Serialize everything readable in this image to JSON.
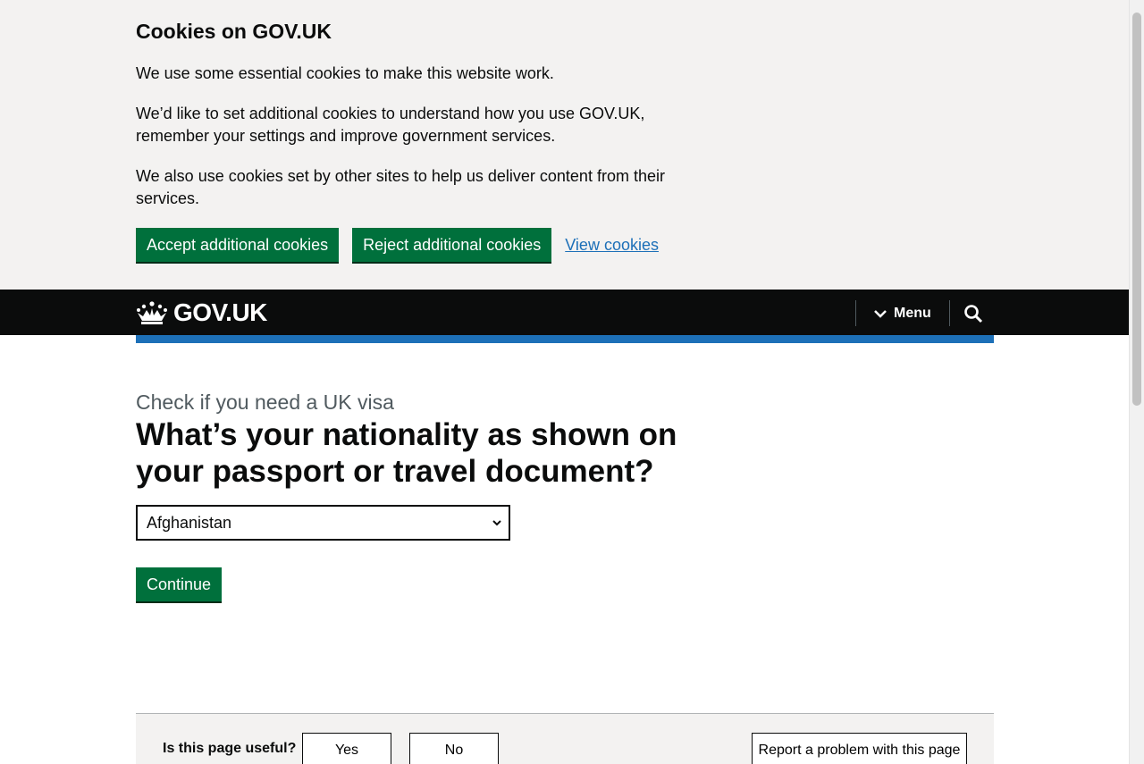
{
  "cookie_banner": {
    "title": "Cookies on GOV.UK",
    "paragraph_1": "We use some essential cookies to make this website work.",
    "paragraph_2": "We’d like to set additional cookies to understand how you use GOV.UK, remember your settings and improve government services.",
    "paragraph_3": "We also use cookies set by other sites to help us deliver content from their services.",
    "accept_label": "Accept additional cookies",
    "reject_label": "Reject additional cookies",
    "view_label": "View cookies"
  },
  "header": {
    "logo_text": "GOV.UK",
    "menu_label": "Menu",
    "search_icon": "search-icon"
  },
  "main": {
    "caption": "Check if you need a UK visa",
    "heading": "What’s your nationality as shown on your passport or travel document?",
    "select_value": "Afghanistan",
    "continue_label": "Continue"
  },
  "feedback": {
    "question": "Is this page useful?",
    "yes_label": "Yes",
    "no_label": "No",
    "report_label": "Report a problem with this page"
  },
  "colors": {
    "brand_green": "#00703c",
    "brand_blue": "#1d70b8",
    "header_black": "#0b0c0c",
    "banner_grey": "#f3f2f1"
  }
}
